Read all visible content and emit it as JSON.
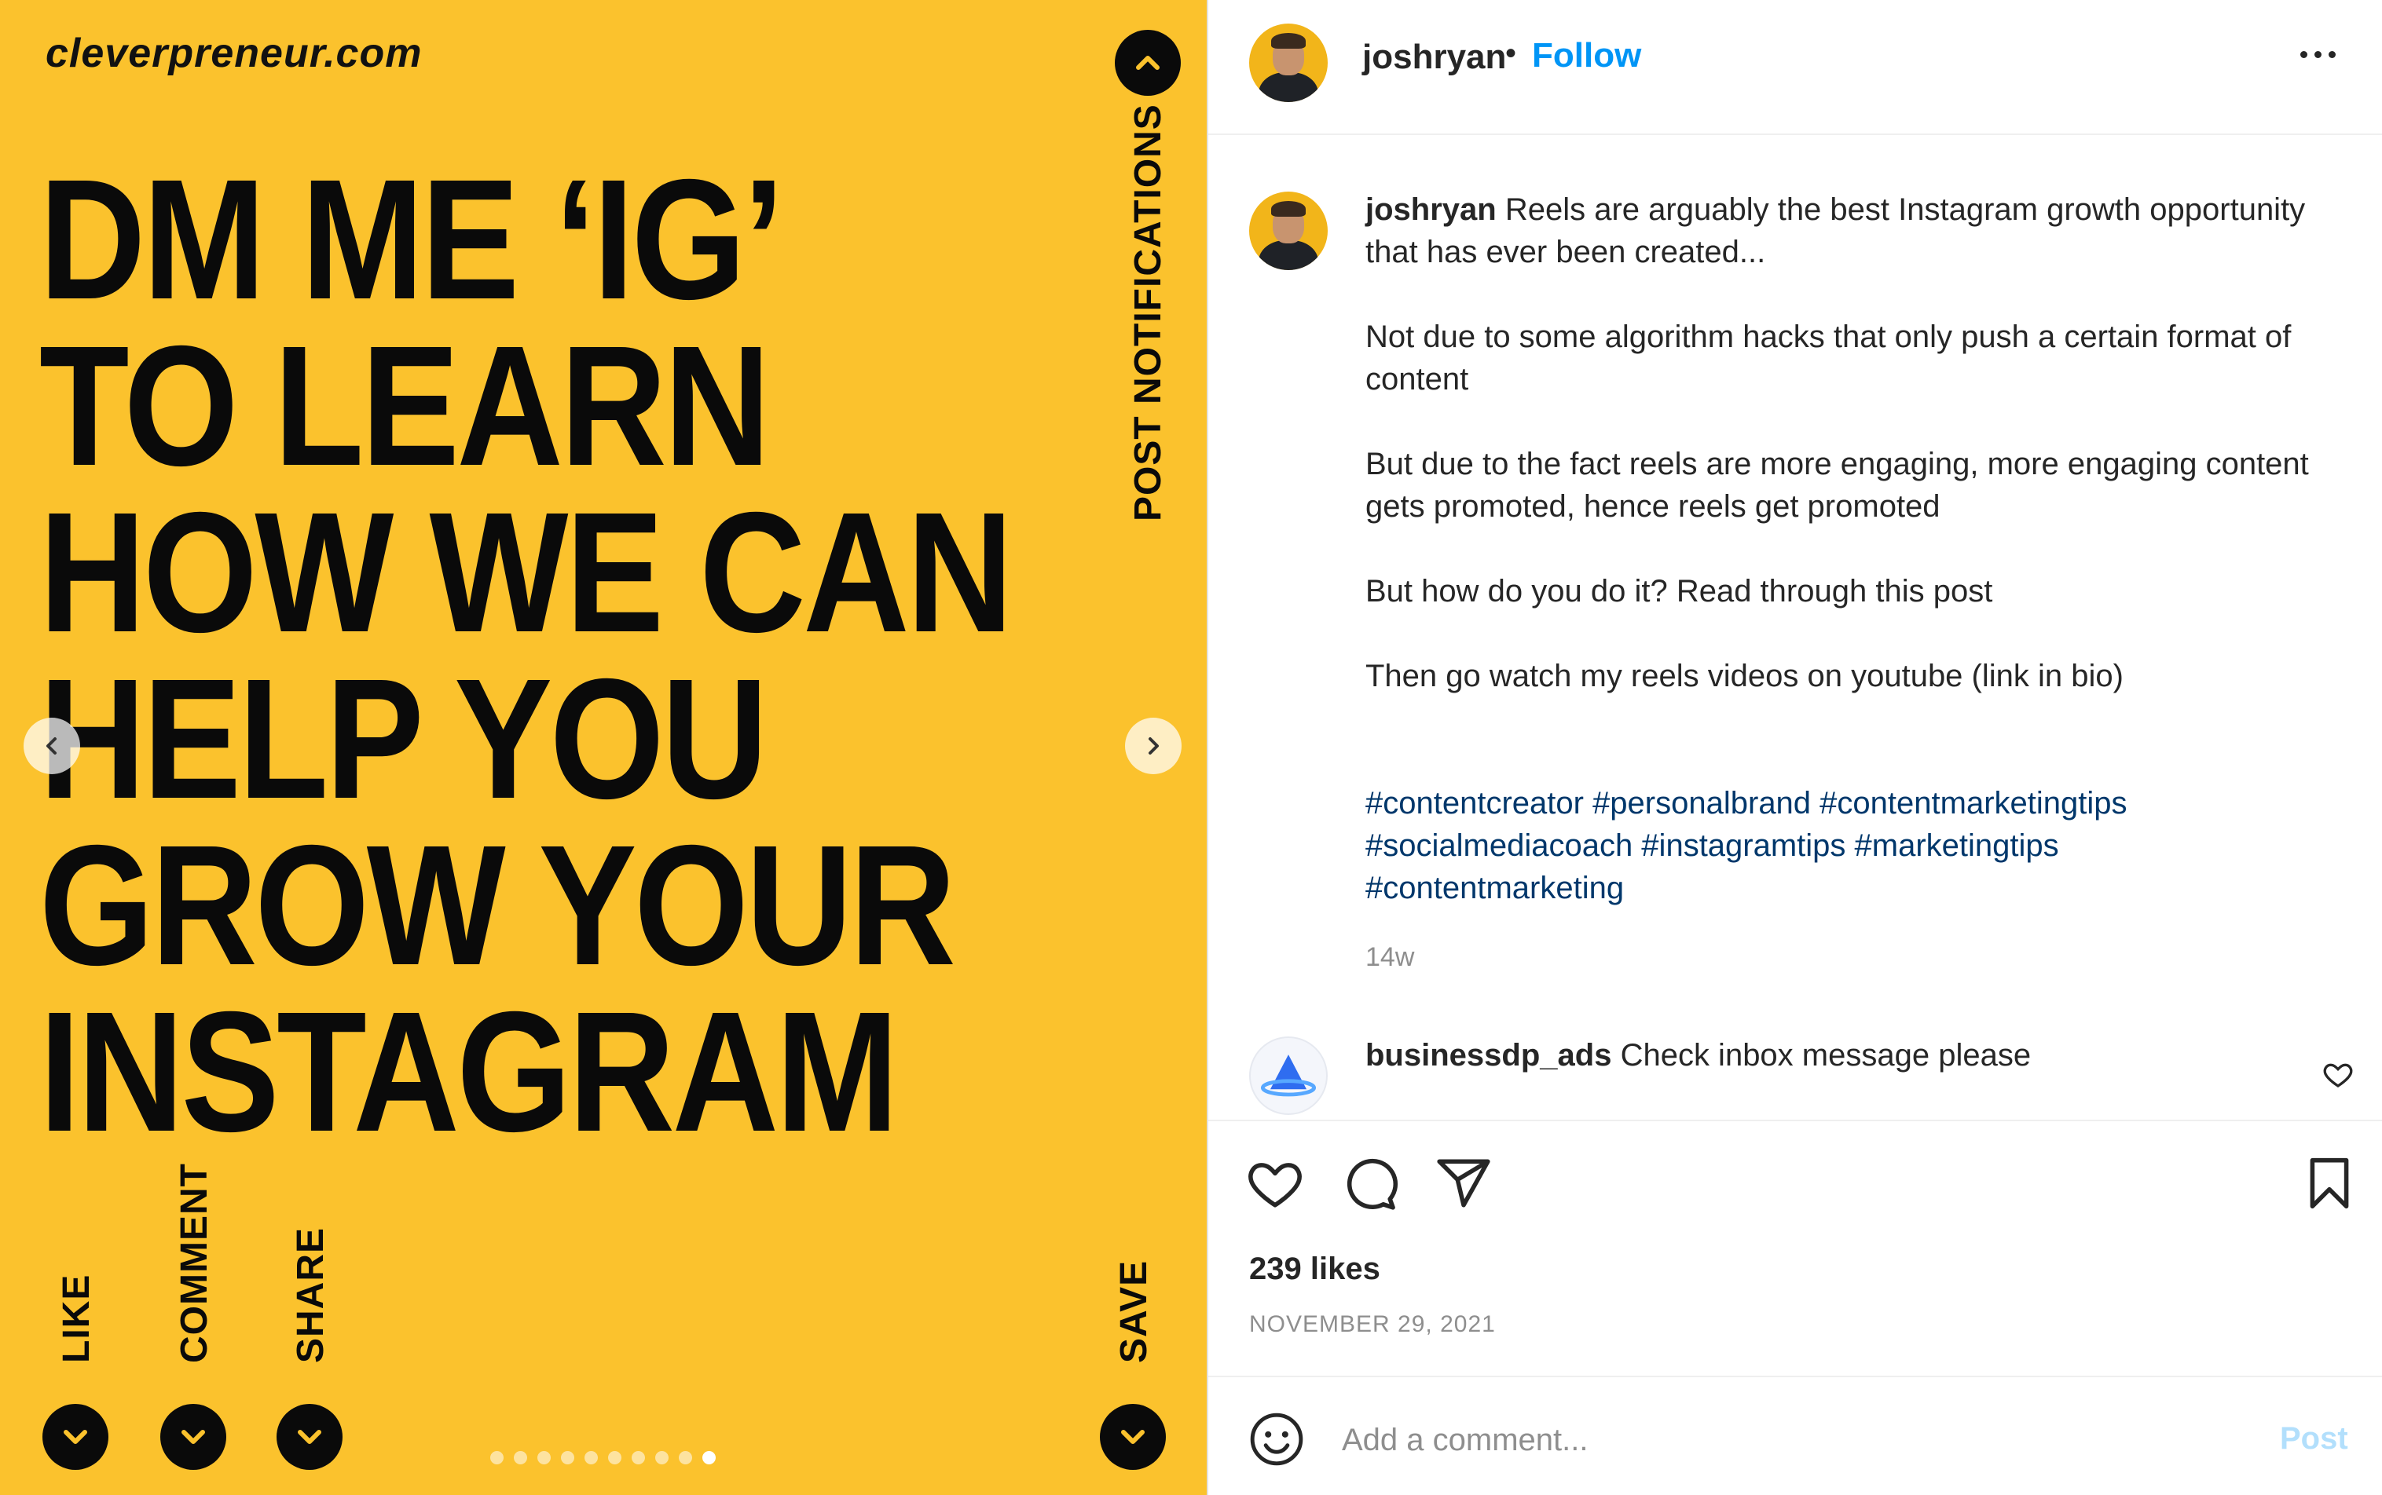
{
  "media": {
    "brand": "cleverpreneur.com",
    "headline_lines": [
      "DM ME ‘IG’",
      "TO LEARN",
      "HOW WE CAN",
      "HELP YOU",
      "GROW YOUR",
      "INSTAGRAM"
    ],
    "labels": {
      "post_notifications": "POST NOTIFICATIONS",
      "like": "LIKE",
      "comment": "COMMENT",
      "share": "SHARE",
      "save": "SAVE"
    },
    "background_color": "#fbc22d",
    "carousel": {
      "total_slides": 10,
      "active_slide": 10
    }
  },
  "post_header": {
    "username": "joshryan",
    "separator": "•",
    "follow_label": "Follow",
    "more_icon": "more-options-icon"
  },
  "caption": {
    "username": "joshryan",
    "paragraphs": [
      "Reels are arguably the best Instagram growth opportunity that has ever been created...",
      "Not due to some algorithm hacks that only push a certain format of content",
      "But due to the fact reels are more engaging, more engaging content gets promoted, hence reels get promoted",
      "But how do you do it? Read through this post",
      "Then go watch my reels videos on youtube (link in bio)"
    ],
    "hashtags": "#contentcreator #personalbrand #contentmarketingtips #socialmediacoach #instagramtips #marketingtips #contentmarketing",
    "age": "14w"
  },
  "comment": {
    "username": "businessdp_ads",
    "text": "Check inbox message please"
  },
  "actions": {
    "likes": "239 likes",
    "date": "NOVEMBER 29, 2021"
  },
  "composer": {
    "placeholder": "Add a comment...",
    "post_label": "Post"
  },
  "colors": {
    "follow_blue": "#0095f6",
    "hashtag_blue": "#00376b",
    "post_disabled": "#b2dffc"
  }
}
